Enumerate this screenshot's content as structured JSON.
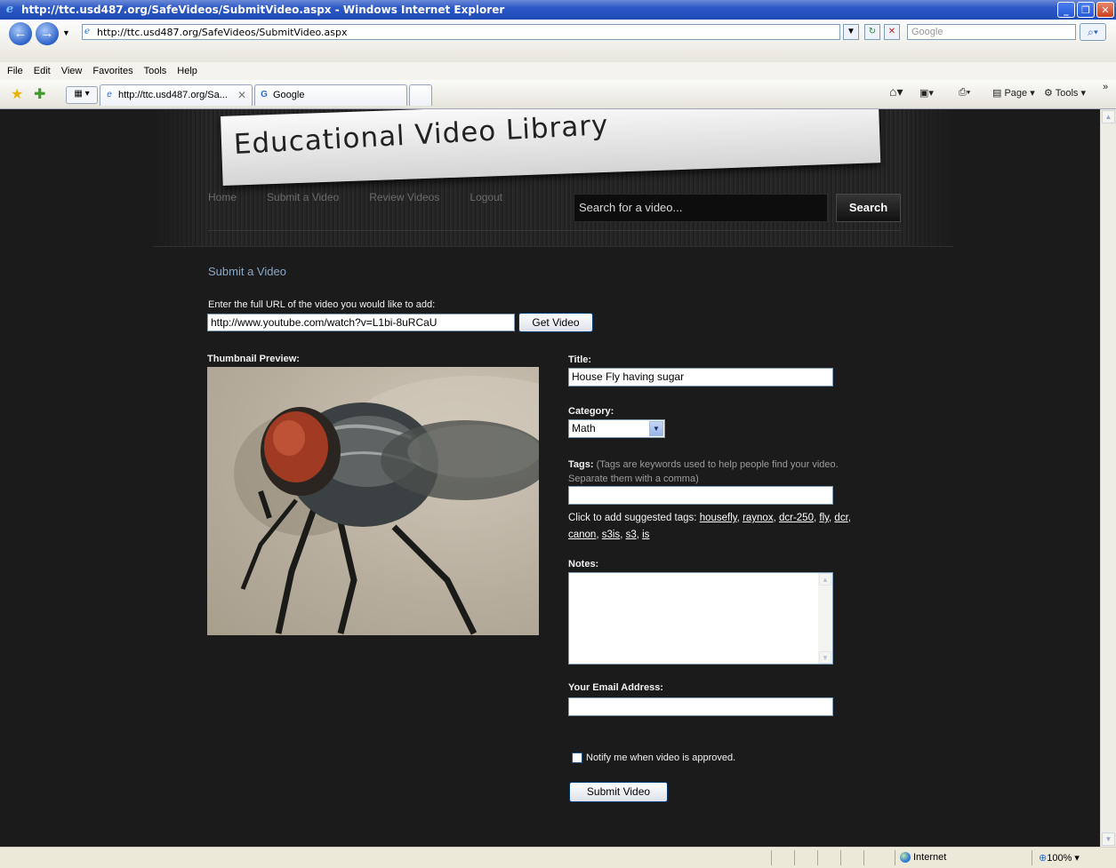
{
  "window": {
    "title": "http://ttc.usd487.org/SafeVideos/SubmitVideo.aspx - Windows Internet Explorer"
  },
  "browser": {
    "address": "http://ttc.usd487.org/SafeVideos/SubmitVideo.aspx",
    "search_placeholder": "Google",
    "menu": [
      "File",
      "Edit",
      "View",
      "Favorites",
      "Tools",
      "Help"
    ],
    "tabs": [
      {
        "label": "http://ttc.usd487.org/Sa...",
        "active": true
      },
      {
        "label": "Google",
        "active": false
      }
    ],
    "toolbar": {
      "page": "Page",
      "tools": "Tools"
    },
    "status": {
      "zone": "Internet",
      "zoom": "100%"
    }
  },
  "site": {
    "banner_title": "Educational Video Library",
    "nav": [
      "Home",
      "Submit a Video",
      "Review Videos",
      "Logout"
    ],
    "search_placeholder": "Search for a video...",
    "search_button": "Search"
  },
  "form": {
    "page_title": "Submit a Video",
    "url_label": "Enter the full URL of the video you would like to add:",
    "url_value": "http://www.youtube.com/watch?v=L1bi-8uRCaU",
    "get_video_button": "Get Video",
    "thumbnail_label": "Thumbnail Preview:",
    "title_label": "Title:",
    "title_value": "House Fly having sugar",
    "category_label": "Category:",
    "category_value": "Math",
    "tags_label": "Tags:",
    "tags_hint_1": "(Tags are keywords used to help people find your video.",
    "tags_hint_2": "Separate them with a comma)",
    "tags_value": "",
    "suggested_prefix": "Click to add suggested tags:",
    "suggested_tags": [
      "housefly",
      "raynox",
      "dcr-250",
      "fly",
      "dcr",
      "canon",
      "s3is",
      "s3",
      "is"
    ],
    "notes_label": "Notes:",
    "email_label": "Your Email Address:",
    "email_value": "",
    "notify_label": "Notify me when video is approved.",
    "notify_checked": false,
    "submit_button": "Submit Video"
  }
}
